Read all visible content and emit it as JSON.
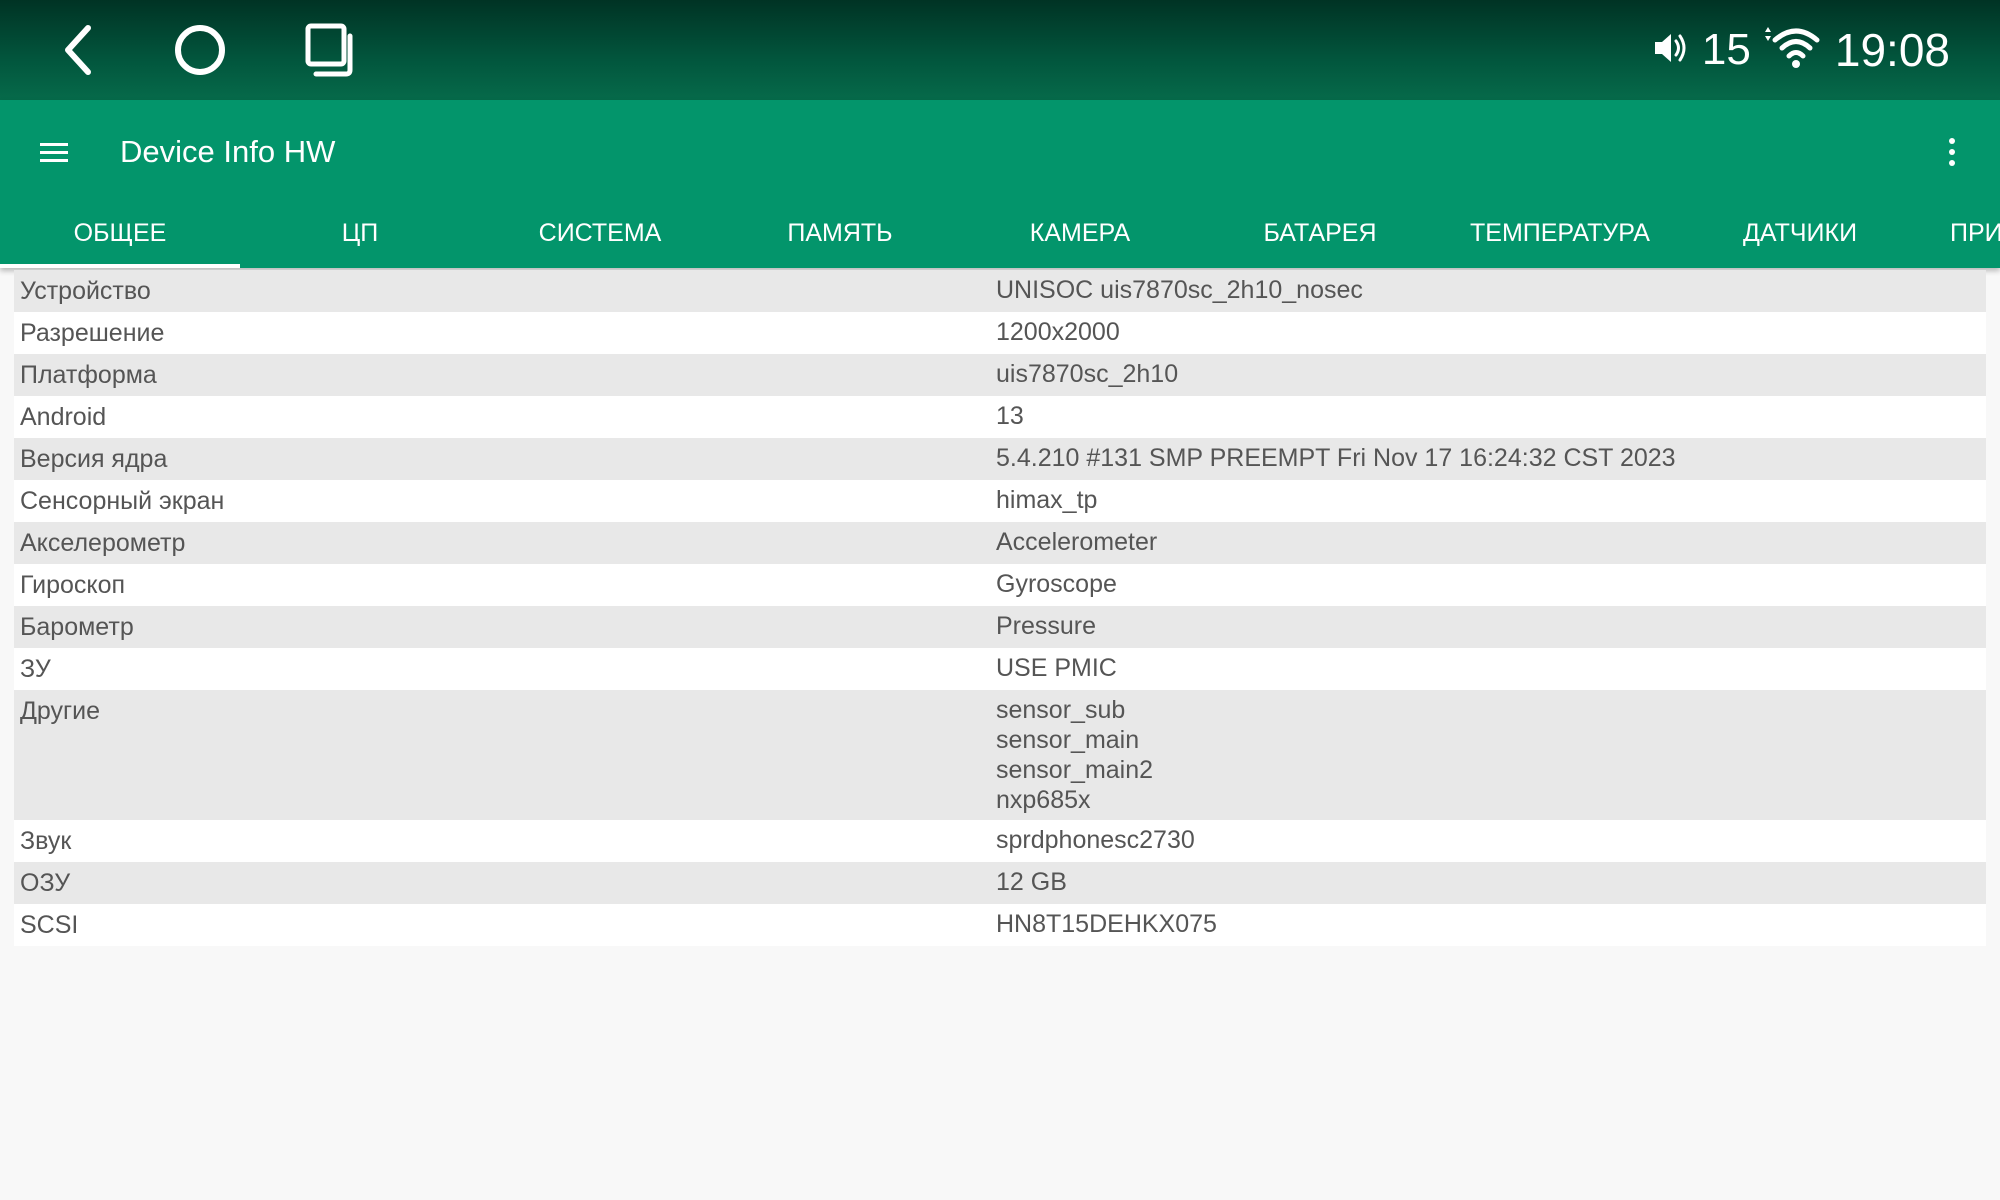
{
  "status_bar": {
    "volume_icon": "volume-icon",
    "volume_level": "15",
    "wifi_icon": "wifi-icon",
    "time": "19:08"
  },
  "nav": {
    "back_icon": "back-icon",
    "home_icon": "home-icon",
    "recents_icon": "recents-icon"
  },
  "app_bar": {
    "title": "Device Info HW",
    "menu_icon": "hamburger-menu-icon",
    "more_icon": "more-vert-icon"
  },
  "tabs": [
    {
      "label": "ОБЩЕЕ",
      "active": true
    },
    {
      "label": "ЦП",
      "active": false
    },
    {
      "label": "СИСТЕМА",
      "active": false
    },
    {
      "label": "ПАМЯТЬ",
      "active": false
    },
    {
      "label": "КАМЕРА",
      "active": false
    },
    {
      "label": "БАТАРЕЯ",
      "active": false
    },
    {
      "label": "ТЕМПЕРАТУРА",
      "active": false
    },
    {
      "label": "ДАТЧИКИ",
      "active": false
    },
    {
      "label": "ПРИ",
      "active": false
    }
  ],
  "rows": [
    {
      "label": "Устройство",
      "values": [
        "UNISOC uis7870sc_2h10_nosec"
      ]
    },
    {
      "label": "Разрешение",
      "values": [
        "1200x2000"
      ]
    },
    {
      "label": "Платформа",
      "values": [
        "uis7870sc_2h10"
      ]
    },
    {
      "label": "Android",
      "values": [
        "13"
      ]
    },
    {
      "label": "Версия ядра",
      "values": [
        "5.4.210 #131 SMP PREEMPT Fri Nov 17 16:24:32 CST 2023"
      ]
    },
    {
      "label": "Сенсорный экран",
      "values": [
        "himax_tp"
      ]
    },
    {
      "label": "Акселерометр",
      "values": [
        "Accelerometer"
      ]
    },
    {
      "label": "Гироскоп",
      "values": [
        "Gyroscope"
      ]
    },
    {
      "label": "Барометр",
      "values": [
        "Pressure"
      ]
    },
    {
      "label": "ЗУ",
      "values": [
        "USE PMIC"
      ]
    },
    {
      "label": "Другие",
      "values": [
        "sensor_sub",
        "sensor_main",
        "sensor_main2",
        "nxp685x"
      ]
    },
    {
      "label": "Звук",
      "values": [
        "sprdphonesc2730"
      ]
    },
    {
      "label": "ОЗУ",
      "values": [
        "12 GB"
      ]
    },
    {
      "label": "SCSI",
      "values": [
        "HN8T15DEHKX075"
      ]
    }
  ],
  "colors": {
    "status_bar": "#02563d",
    "app_bar": "#03956b",
    "row_alt": "#e8e8e8",
    "text": "#555555"
  }
}
